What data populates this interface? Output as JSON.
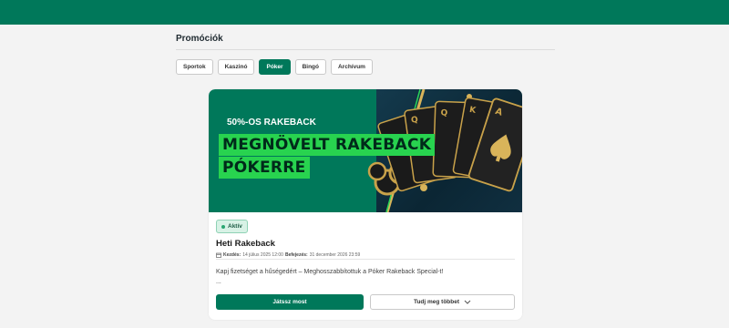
{
  "header": {
    "color": "#00785a"
  },
  "page": {
    "title": "Promóciók"
  },
  "tabs": [
    {
      "label": "Sportok",
      "active": false
    },
    {
      "label": "Kaszinó",
      "active": false
    },
    {
      "label": "Póker",
      "active": true
    },
    {
      "label": "Bingó",
      "active": false
    },
    {
      "label": "Archívum",
      "active": false
    }
  ],
  "promo": {
    "banner": {
      "subtitle": "50%-OS RAKEBACK",
      "title_line1": "MEGNÖVELT RAKEBACK",
      "title_line2": "PÓKERRE",
      "image": "playing-cards-and-chips"
    },
    "status": "Aktív",
    "title": "Heti Rakeback",
    "start_label": "Kezdés:",
    "start_value": "14 július 2025 12:00",
    "end_label": "Befejezés:",
    "end_value": "31 december 2026 23:59",
    "description": "Kapj fizetséget a hűségedért – Meghosszabbítottuk a Póker Rakeback Special-t!",
    "ellipsis": "...",
    "play_button": "Játssz most",
    "more_button": "Tudj meg többet"
  },
  "colors": {
    "accent": "#00785a",
    "banner_highlight": "#28d34f",
    "card_gold": "#c9a24a"
  }
}
